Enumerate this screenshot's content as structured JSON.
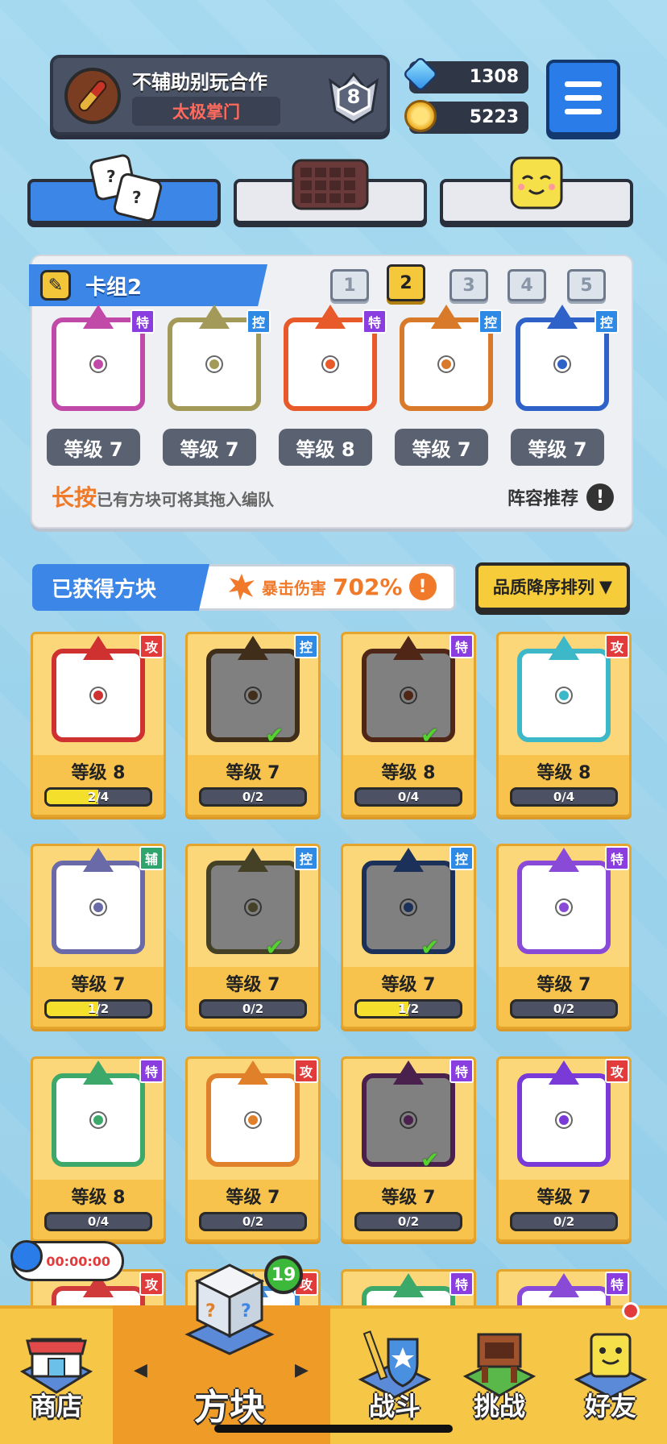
{
  "profile": {
    "name": "不辅助别玩合作",
    "title": "太极掌门",
    "rank": "8"
  },
  "currency": {
    "gems": "1308",
    "coins": "5223"
  },
  "deck": {
    "title": "卡组2",
    "tabs": [
      "1",
      "2",
      "3",
      "4",
      "5"
    ],
    "selected_tab": "2",
    "blocks": [
      {
        "tag": "特",
        "level": "等级 7",
        "color": "#c14aa8"
      },
      {
        "tag": "控",
        "level": "等级 7",
        "color": "#a39a5a"
      },
      {
        "tag": "特",
        "level": "等级 8",
        "color": "#e85a2a"
      },
      {
        "tag": "控",
        "level": "等级 7",
        "color": "#d97a2a"
      },
      {
        "tag": "控",
        "level": "等级 7",
        "color": "#2f62c9"
      }
    ],
    "hint_emph": "长按",
    "hint_text": "已有方块可将其拖入编队",
    "recommend": "阵容推荐",
    "recommend_icon": "!"
  },
  "owned": {
    "title": "已获得方块",
    "crit_label": "暴击伤害",
    "crit_value": "702%",
    "crit_icon": "!",
    "sort": "品质降序排列",
    "sort_arrow": "▼",
    "cards": [
      {
        "tag": "攻",
        "tagclass": "b-atk",
        "level": "等级 8",
        "progress": "2/4",
        "fill": 0.5,
        "color": "#cf3030",
        "owned_in_deck": false,
        "dim": false
      },
      {
        "tag": "控",
        "tagclass": "b-ctl",
        "level": "等级 7",
        "progress": "0/2",
        "fill": 0,
        "color": "#8a5a2a",
        "owned_in_deck": true,
        "dim": true
      },
      {
        "tag": "特",
        "tagclass": "b-sp",
        "level": "等级 8",
        "progress": "0/4",
        "fill": 0,
        "color": "#b04a22",
        "owned_in_deck": true,
        "dim": true
      },
      {
        "tag": "攻",
        "tagclass": "b-atk",
        "level": "等级 8",
        "progress": "0/4",
        "fill": 0,
        "color": "#3cb8c8",
        "owned_in_deck": false,
        "dim": false
      },
      {
        "tag": "辅",
        "tagclass": "b-sup",
        "level": "等级 7",
        "progress": "1/2",
        "fill": 0.5,
        "color": "#6a6aa8",
        "owned_in_deck": false,
        "dim": false
      },
      {
        "tag": "控",
        "tagclass": "b-ctl",
        "level": "等级 7",
        "progress": "0/2",
        "fill": 0,
        "color": "#8a8240",
        "owned_in_deck": true,
        "dim": true
      },
      {
        "tag": "控",
        "tagclass": "b-ctl",
        "level": "等级 7",
        "progress": "1/2",
        "fill": 0.5,
        "color": "#2f62c9",
        "owned_in_deck": true,
        "dim": true
      },
      {
        "tag": "特",
        "tagclass": "b-sp",
        "level": "等级 7",
        "progress": "0/2",
        "fill": 0,
        "color": "#8a4ad8",
        "owned_in_deck": false,
        "dim": false
      },
      {
        "tag": "特",
        "tagclass": "b-sp",
        "level": "等级 8",
        "progress": "0/4",
        "fill": 0,
        "color": "#3ca86a",
        "owned_in_deck": false,
        "dim": false
      },
      {
        "tag": "攻",
        "tagclass": "b-atk",
        "level": "等级 7",
        "progress": "0/2",
        "fill": 0,
        "color": "#e0802a",
        "owned_in_deck": false,
        "dim": false
      },
      {
        "tag": "特",
        "tagclass": "b-sp",
        "level": "等级 7",
        "progress": "0/2",
        "fill": 0,
        "color": "#a33aa8",
        "owned_in_deck": true,
        "dim": true
      },
      {
        "tag": "攻",
        "tagclass": "b-atk",
        "level": "等级 7",
        "progress": "0/2",
        "fill": 0,
        "color": "#7a3ad8",
        "owned_in_deck": false,
        "dim": false
      },
      {
        "tag": "攻",
        "tagclass": "b-atk",
        "color": "#d03a3a"
      },
      {
        "tag": "攻",
        "tagclass": "b-atk",
        "color": "#3c8ad8"
      },
      {
        "tag": "特",
        "tagclass": "b-sp",
        "color": "#3ca86a"
      },
      {
        "tag": "特",
        "tagclass": "b-sp",
        "color": "#8a4ad8"
      }
    ]
  },
  "timer": "00:00:00",
  "nav": {
    "shop": "商店",
    "blocks": "方块",
    "battle": "战斗",
    "challenge": "挑战",
    "friends": "好友",
    "blocks_badge": "19",
    "prev_arrow": "◀",
    "next_arrow": "▶"
  }
}
